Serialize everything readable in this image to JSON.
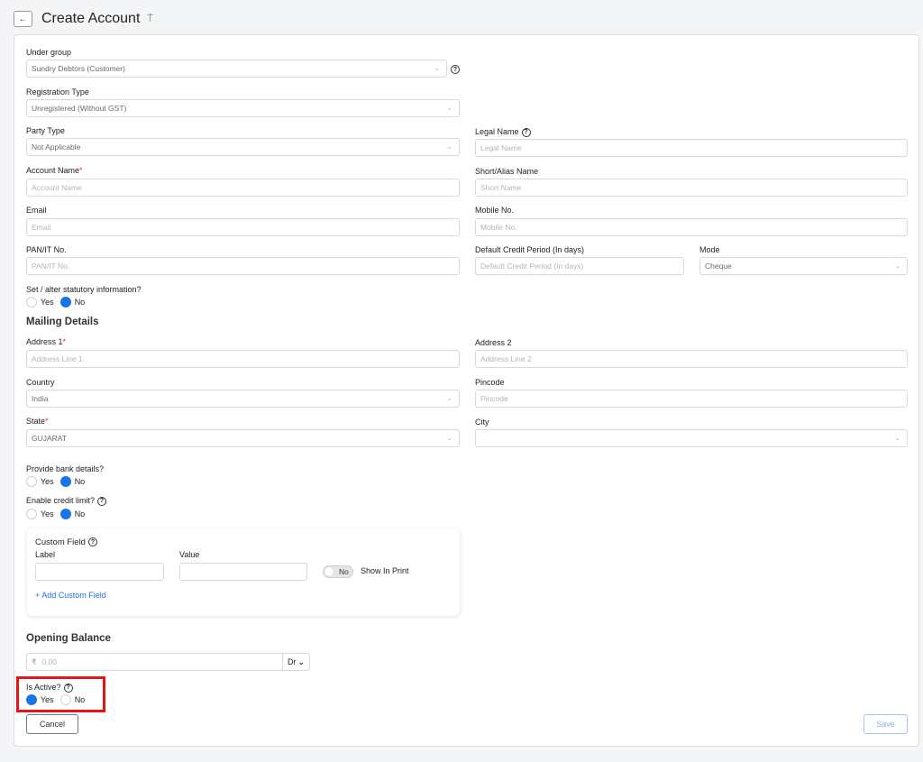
{
  "header": {
    "title": "Create Account",
    "back_icon": "←",
    "pin_icon": "⍑"
  },
  "fields": {
    "under_group": {
      "label": "Under group",
      "value": "Sundry Debtors (Customer)"
    },
    "registration_type": {
      "label": "Registration Type",
      "value": "Unregistered (Without GST)"
    },
    "party_type": {
      "label": "Party Type",
      "value": "Not Applicable"
    },
    "legal_name": {
      "label": "Legal Name",
      "placeholder": "Legal Name"
    },
    "account_name": {
      "label": "Account Name",
      "placeholder": "Account Name"
    },
    "short_name": {
      "label": "Short/Alias Name",
      "placeholder": "Short Name"
    },
    "email": {
      "label": "Email",
      "placeholder": "Email"
    },
    "mobile": {
      "label": "Mobile No.",
      "placeholder": "Mobile No."
    },
    "pan": {
      "label": "PAN/IT No.",
      "placeholder": "PAN/IT No."
    },
    "credit_period": {
      "label": "Default Credit Period (In days)",
      "placeholder": "Default Credit Period (In days)"
    },
    "mode": {
      "label": "Mode",
      "value": "Cheque"
    }
  },
  "statutory": {
    "question": "Set / alter statutory information?",
    "yes": "Yes",
    "no": "No",
    "selected": "No"
  },
  "mailing": {
    "title": "Mailing Details",
    "address1": {
      "label": "Address 1",
      "placeholder": "Address Line 1"
    },
    "address2": {
      "label": "Address 2",
      "placeholder": "Address Line 2"
    },
    "country": {
      "label": "Country",
      "value": "India"
    },
    "pincode": {
      "label": "Pincode",
      "placeholder": "Pincode"
    },
    "state": {
      "label": "State",
      "value": "GUJARAT"
    },
    "city": {
      "label": "City",
      "value": ""
    }
  },
  "bank": {
    "question": "Provide bank details?",
    "yes": "Yes",
    "no": "No",
    "selected": "No"
  },
  "credit_limit": {
    "question": "Enable credit limit?",
    "yes": "Yes",
    "no": "No",
    "selected": "No"
  },
  "custom_field": {
    "title": "Custom Field",
    "label_col": "Label",
    "value_col": "Value",
    "toggle": "No",
    "show_in_print": "Show In Print",
    "add_link": "+ Add Custom Field"
  },
  "opening_balance": {
    "title": "Opening Balance",
    "currency": "₹",
    "placeholder": "0.00",
    "drcr": "Dr",
    "drcr_chevron": "⌄"
  },
  "is_active": {
    "question": "Is Active?",
    "yes": "Yes",
    "no": "No",
    "selected": "Yes"
  },
  "actions": {
    "cancel": "Cancel",
    "save": "Save"
  },
  "icons": {
    "chevron": "⌄",
    "help": "?"
  },
  "colors": {
    "accent": "#1a73e8",
    "required": "#e03030",
    "highlight": "#e3151b"
  }
}
